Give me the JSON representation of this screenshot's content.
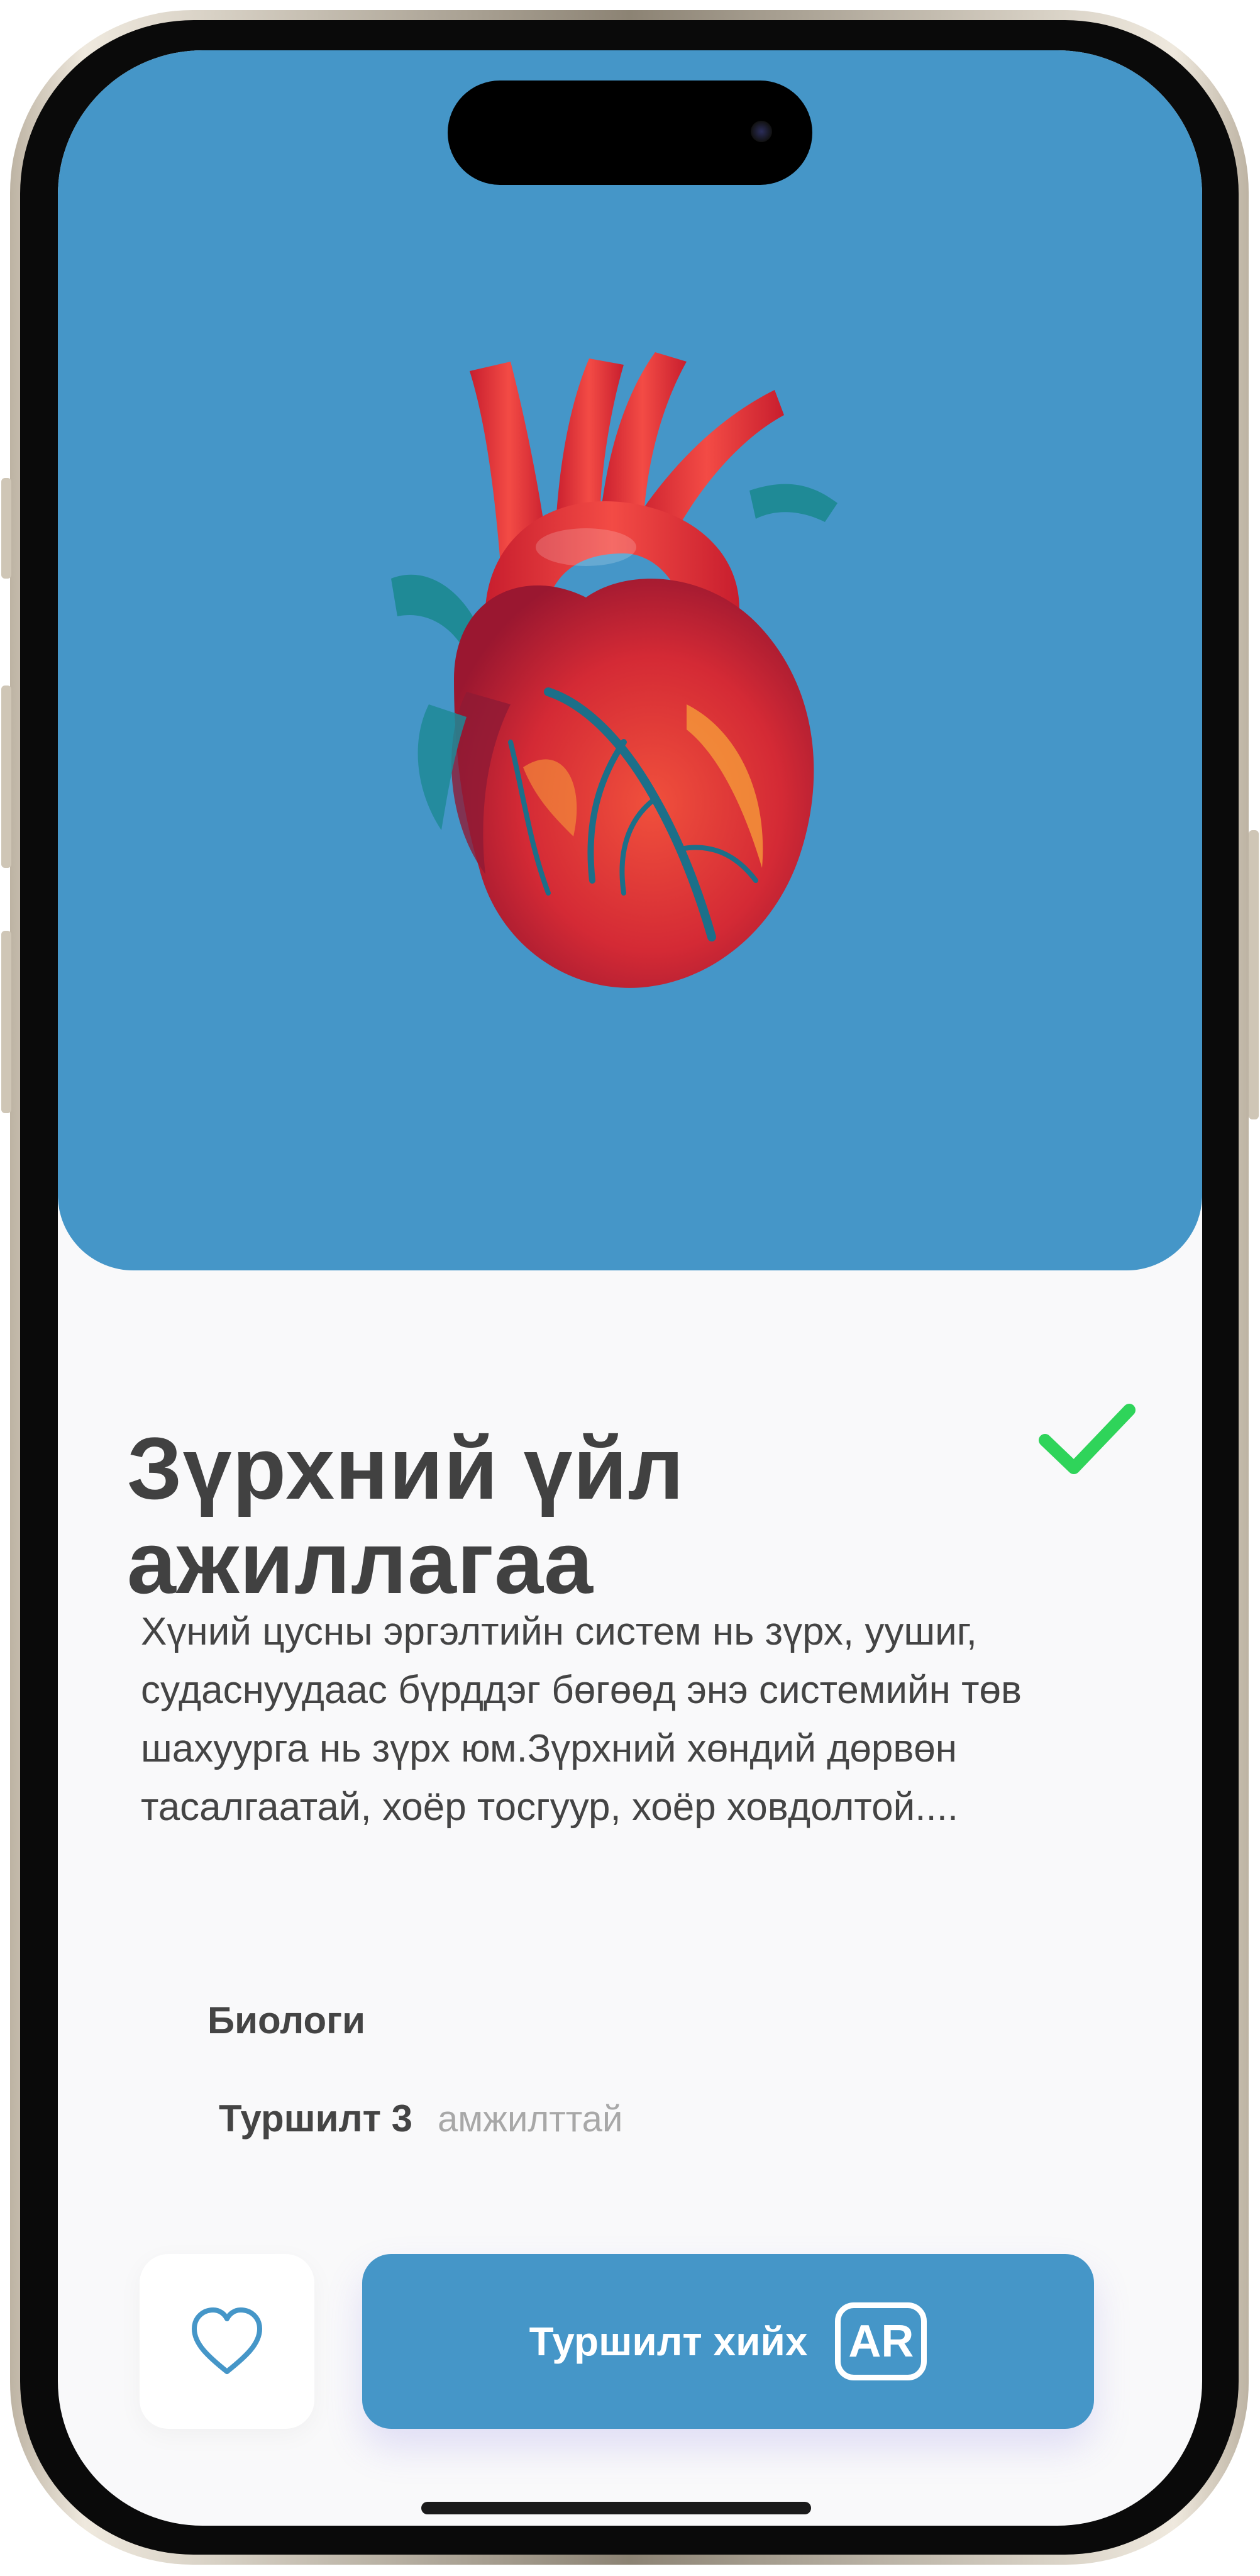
{
  "lesson": {
    "title": "Зүрхний үйл ажиллагаа",
    "completed": true,
    "description": "Хүний цусны эргэлтийн систем нь зүрх, уушиг, судаснуудаас бүрддэг бөгөөд энэ системийн төв шахуурга нь зүрх юм.Зүрхний хөндий дөрвөн тасалгаатай, хоёр тосгуур, хоёр ховдолтой....",
    "subject": "Биологи",
    "attempt_label": "Туршилт 3",
    "attempt_result": "амжилттай"
  },
  "actions": {
    "favorite_icon": "heart-outline-icon",
    "try_label": "Туршилт хийх",
    "ar_badge": "AR"
  },
  "colors": {
    "accent": "#4596c8",
    "check": "#2fd45a",
    "background": "#f9f9fa",
    "title_text": "#414141"
  }
}
